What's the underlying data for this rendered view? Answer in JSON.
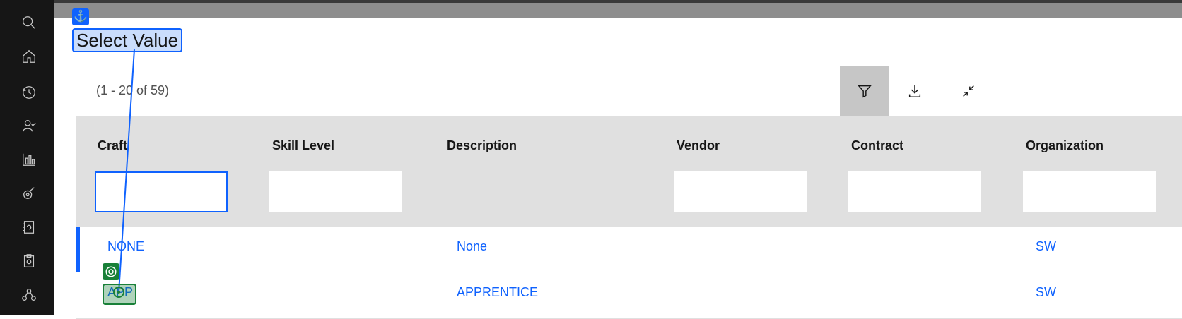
{
  "rail": {
    "icons": [
      "search-icon",
      "home-icon",
      "history-icon",
      "user-check-icon",
      "chart-icon",
      "asset-icon",
      "workorder-icon",
      "clipboard-icon",
      "network-icon"
    ]
  },
  "dialog": {
    "title": "Select Value",
    "count": "(1 - 20 of 59)"
  },
  "toolbar": {
    "clear_filter": "clear-filter-icon",
    "filter": "filter-icon",
    "download": "download-icon",
    "collapse": "collapse-icon"
  },
  "table": {
    "columns": [
      "Craft",
      "Skill Level",
      "Description",
      "Vendor",
      "Contract",
      "Organization"
    ],
    "filters": {
      "craft": "",
      "skill_level": "",
      "vendor": "",
      "contract": "",
      "organization": ""
    },
    "rows": [
      {
        "craft": "NONE",
        "skill_level": "",
        "description": "None",
        "vendor": "",
        "contract": "",
        "organization": "SW"
      },
      {
        "craft": "APP",
        "skill_level": "",
        "description": "APPRENTICE",
        "vendor": "",
        "contract": "",
        "organization": "SW"
      }
    ]
  },
  "colors": {
    "accent": "#0f62fe",
    "rail": "#161616",
    "header": "#e0e0e0",
    "target": "#198038"
  }
}
